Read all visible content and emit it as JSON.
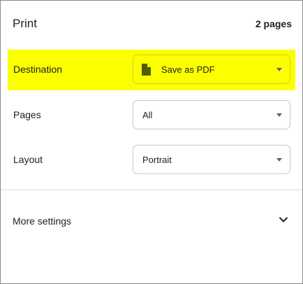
{
  "header": {
    "title": "Print",
    "page_count": "2 pages"
  },
  "settings": {
    "destination": {
      "label": "Destination",
      "value": "Save as PDF",
      "icon": "document-icon",
      "highlight_color": "#fbff00"
    },
    "pages": {
      "label": "Pages",
      "value": "All"
    },
    "layout": {
      "label": "Layout",
      "value": "Portrait"
    }
  },
  "more_settings": {
    "label": "More settings",
    "icon": "chevron-down-icon"
  }
}
